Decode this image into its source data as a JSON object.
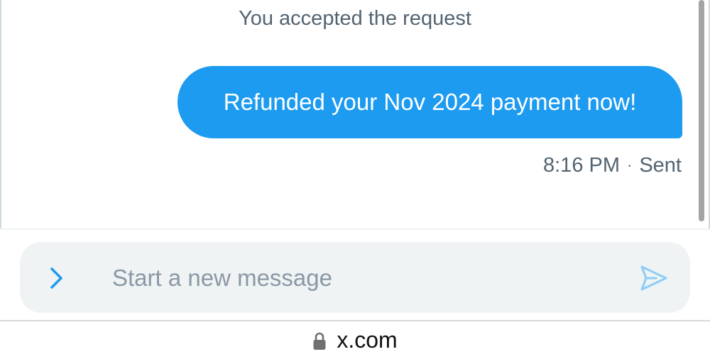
{
  "thread": {
    "system_note": "You accepted the request",
    "messages": [
      {
        "text": "Refunded your Nov 2024 payment now!",
        "time": "8:16 PM",
        "separator": "·",
        "status": "Sent",
        "direction": "outgoing"
      }
    ]
  },
  "composer": {
    "placeholder": "Start a new message",
    "value": "",
    "expand_icon": "chevron-right-icon",
    "send_icon": "send-icon"
  },
  "browser": {
    "url": "x.com",
    "lock_icon": "lock-icon"
  },
  "colors": {
    "accent": "#1d9bf0",
    "muted_text": "#536471",
    "composer_bg": "#eff3f4",
    "placeholder": "#8b98a5"
  }
}
